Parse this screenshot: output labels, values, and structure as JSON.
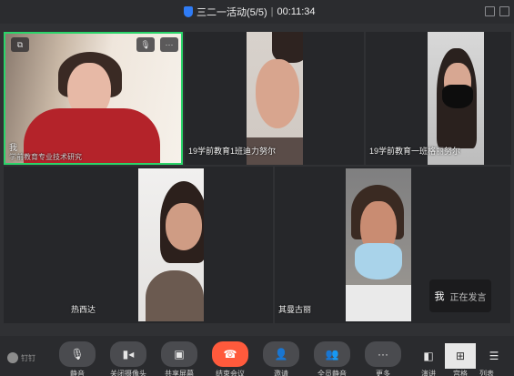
{
  "titlebar": {
    "meeting_name": "三二一活动(5/5)",
    "separator": "|",
    "elapsed_time": "00:11:34"
  },
  "participants": [
    {
      "name": "我",
      "subtitle": "学前教育专业技术研究",
      "speaking": true
    },
    {
      "name": "19学前教育1班迪力努尔"
    },
    {
      "name": "19学前教育一班格丽努尔"
    },
    {
      "name": "热西达"
    },
    {
      "name": "其曼古丽"
    }
  ],
  "speaking_popup": {
    "who": "我",
    "status": "正在发言"
  },
  "brand": {
    "label": "钉钉"
  },
  "toolbar": {
    "buttons": [
      {
        "id": "mute",
        "icon": "microphone-icon",
        "label": "静音"
      },
      {
        "id": "camera",
        "icon": "camera-icon",
        "label": "关闭摄像头"
      },
      {
        "id": "share",
        "icon": "share-screen-icon",
        "label": "共享屏幕"
      },
      {
        "id": "end",
        "icon": "hang-up-icon",
        "label": "结束会议"
      },
      {
        "id": "invite",
        "icon": "add-user-icon",
        "label": "邀请"
      },
      {
        "id": "members",
        "icon": "members-icon",
        "label": "全员静音"
      },
      {
        "id": "more",
        "icon": "more-icon",
        "label": "更多"
      }
    ],
    "layouts": [
      {
        "id": "speaker",
        "icon": "speaker-view-icon",
        "label": "演讲"
      },
      {
        "id": "grid",
        "icon": "grid-view-icon",
        "label": "宫格",
        "selected": true
      },
      {
        "id": "list",
        "icon": "list-view-icon",
        "label": "列表"
      }
    ]
  },
  "colors": {
    "active_border": "#2bd46a",
    "end_button": "#ff5a3c",
    "shield": "#2f7cf6"
  }
}
